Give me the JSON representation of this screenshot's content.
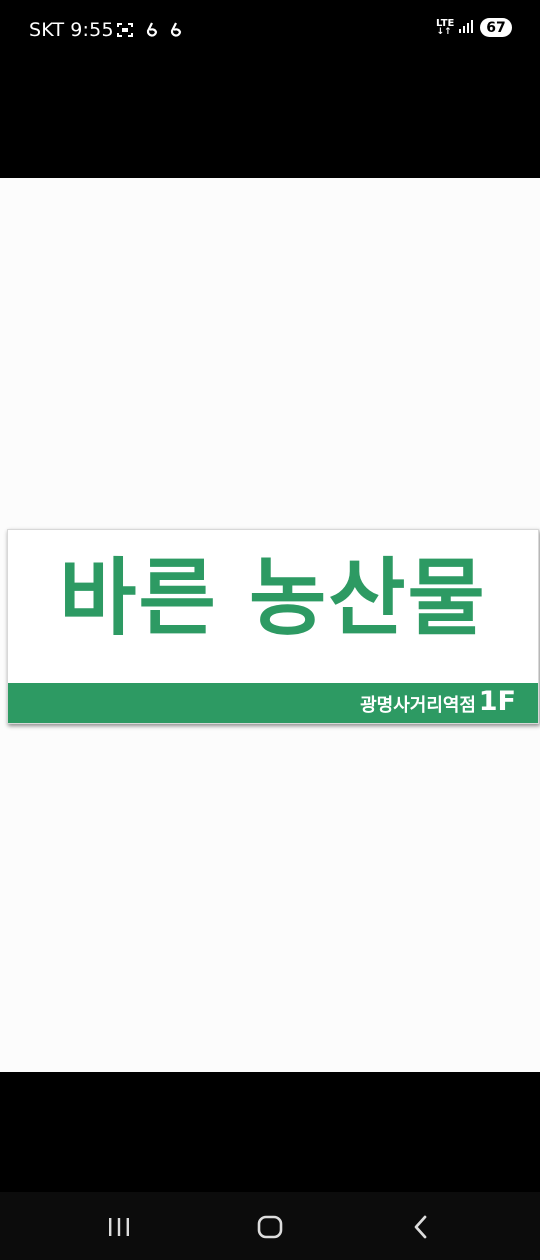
{
  "status_bar": {
    "carrier": "SKT",
    "time": "9:55",
    "network": "LTE",
    "battery": "67",
    "icons_left": [
      "screenshot-icon",
      "notification-icon",
      "notification-icon"
    ],
    "icons_right": [
      "lte-icon",
      "signal-icon",
      "battery-icon"
    ]
  },
  "image": {
    "title": "바른 농산물",
    "branch": "광명사거리역점",
    "floor": "1F",
    "brand_color": "#2d9a63"
  },
  "nav_bar": {
    "buttons": [
      "recent-apps-icon",
      "home-icon",
      "back-icon"
    ]
  }
}
